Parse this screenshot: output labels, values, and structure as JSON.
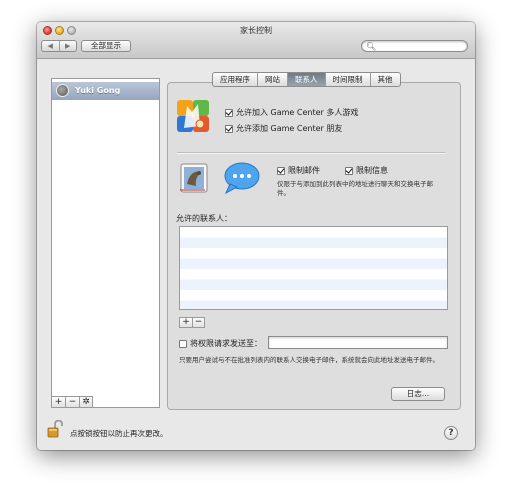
{
  "window": {
    "title": "家长控制"
  },
  "toolbar": {
    "back_glyph": "◀",
    "forward_glyph": "▶",
    "show_all_label": "全部显示",
    "search_placeholder": "",
    "search_icon": "search-icon"
  },
  "sidebar": {
    "users": [
      {
        "name": "Yuki Gong",
        "selected": true
      }
    ],
    "add_glyph": "+",
    "remove_glyph": "−",
    "action_glyph": "✲"
  },
  "tabs": [
    {
      "label": "应用程序",
      "active": false
    },
    {
      "label": "网站",
      "active": false
    },
    {
      "label": "联系人",
      "active": true
    },
    {
      "label": "时间限制",
      "active": false
    },
    {
      "label": "其他",
      "active": false
    }
  ],
  "game_center": {
    "icon": "game-center-icon",
    "allow_multiplayer_label": "允许加入 Game Center 多人游戏",
    "allow_multiplayer_checked": true,
    "allow_friends_label": "允许添加 Game Center 朋友",
    "allow_friends_checked": true
  },
  "mail_messages": {
    "mail_icon": "mail-icon",
    "messages_icon": "messages-icon",
    "limit_mail_label": "限制邮件",
    "limit_mail_checked": true,
    "limit_messages_label": "限制信息",
    "limit_messages_checked": true,
    "note": "仅限于与添加到此列表中的地址进行聊天和交换电子邮件。"
  },
  "contacts": {
    "label": "允许的联系人：",
    "items": [],
    "add_glyph": "+",
    "remove_glyph": "−"
  },
  "permission": {
    "send_request_label": "将权限请求发送至：",
    "send_request_checked": false,
    "value": "",
    "explain": "只要用户尝试与不在批准列表内的联系人交换电子邮件，系统就会向此地址发送电子邮件。"
  },
  "log_button_label": "日志…",
  "footer": {
    "lock_text": "点按锁按钮以防止再次更改。",
    "help_glyph": "?"
  },
  "colors": {
    "selection": "#9fb0c8",
    "active_tab": "#7d8792",
    "close": "#e0443a",
    "minimize": "#e9b52d",
    "list_stripe": "#edf3fd"
  }
}
